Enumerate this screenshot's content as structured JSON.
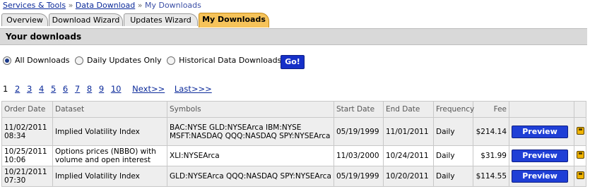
{
  "breadcrumb": {
    "items": [
      "Services & Tools",
      "Data Download"
    ],
    "separator": "»",
    "current": "My Downloads"
  },
  "tabs": [
    {
      "label": "Overview",
      "active": false
    },
    {
      "label": "Download Wizard",
      "active": false
    },
    {
      "label": "Updates Wizard",
      "active": false
    },
    {
      "label": "My Downloads",
      "active": true
    }
  ],
  "section_title": "Your downloads",
  "filters": {
    "options": [
      {
        "label": "All Downloads",
        "selected": true
      },
      {
        "label": "Daily Updates Only",
        "selected": false
      },
      {
        "label": "Historical Data Downloads",
        "selected": false
      }
    ],
    "go_label": "Go!"
  },
  "pager": {
    "pages": [
      "1",
      "2",
      "3",
      "4",
      "5",
      "6",
      "7",
      "8",
      "9",
      "10"
    ],
    "current": "1",
    "next": "Next>>",
    "last": "Last>>>"
  },
  "table": {
    "columns": [
      "Order Date",
      "Dataset",
      "Symbols",
      "Start Date",
      "End Date",
      "Frequency",
      "Fee"
    ],
    "rows": [
      {
        "order_date": "11/02/2011 08:34",
        "dataset": "Implied Volatility Index",
        "symbols": "BAC:NYSE GLD:NYSEArca IBM:NYSE MSFT:NASDAQ QQQ:NASDAQ SPY:NYSEArca",
        "start": "05/19/1999",
        "end": "11/01/2011",
        "frequency": "Daily",
        "fee": "$214.14",
        "action": "Preview"
      },
      {
        "order_date": "10/25/2011 10:06",
        "dataset": "Options prices (NBBO) with volume and open interest",
        "symbols": "XLI:NYSEArca",
        "start": "11/03/2000",
        "end": "10/24/2011",
        "frequency": "Daily",
        "fee": "$31.99",
        "action": "Preview"
      },
      {
        "order_date": "10/21/2011 07:30",
        "dataset": "Implied Volatility Index",
        "symbols": "GLD:NYSEArca QQQ:NASDAQ SPY:NYSEArca",
        "start": "05/19/1999",
        "end": "10/20/2011",
        "frequency": "Daily",
        "fee": "$114.55",
        "action": "Preview"
      }
    ]
  },
  "colors": {
    "active_tab": "#f6c35a",
    "button_blue": "#1f3fd6",
    "link_blue": "#0b2a9a"
  }
}
